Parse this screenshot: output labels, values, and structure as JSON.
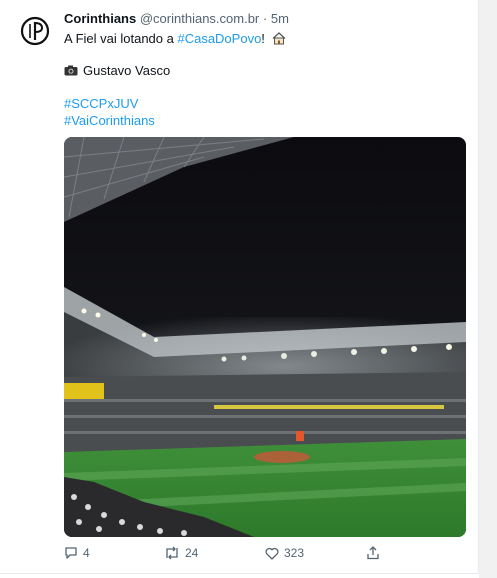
{
  "tweet": {
    "author_name": "Corinthians",
    "handle": "@corinthians.com.br",
    "separator": "·",
    "time": "5m",
    "line1_text": "A Fiel vai lotando a ",
    "line1_hashtag": "#CasaDoPovo",
    "line1_suffix": "!",
    "line1_emoji_icon": "house-icon",
    "photographer_icon": "camera-icon",
    "photographer": "Gustavo Vasco",
    "hashtags": [
      "#SCCPxJUV",
      "#VaiCorinthians"
    ],
    "image_alt_icon": "stadium-photo"
  },
  "actions": {
    "replies": "4",
    "retweets": "24",
    "likes": "323"
  },
  "colors": {
    "link": "#1d9bf0",
    "text": "#0f1419",
    "muted": "#536471",
    "pitch": "#2f7a2c"
  }
}
